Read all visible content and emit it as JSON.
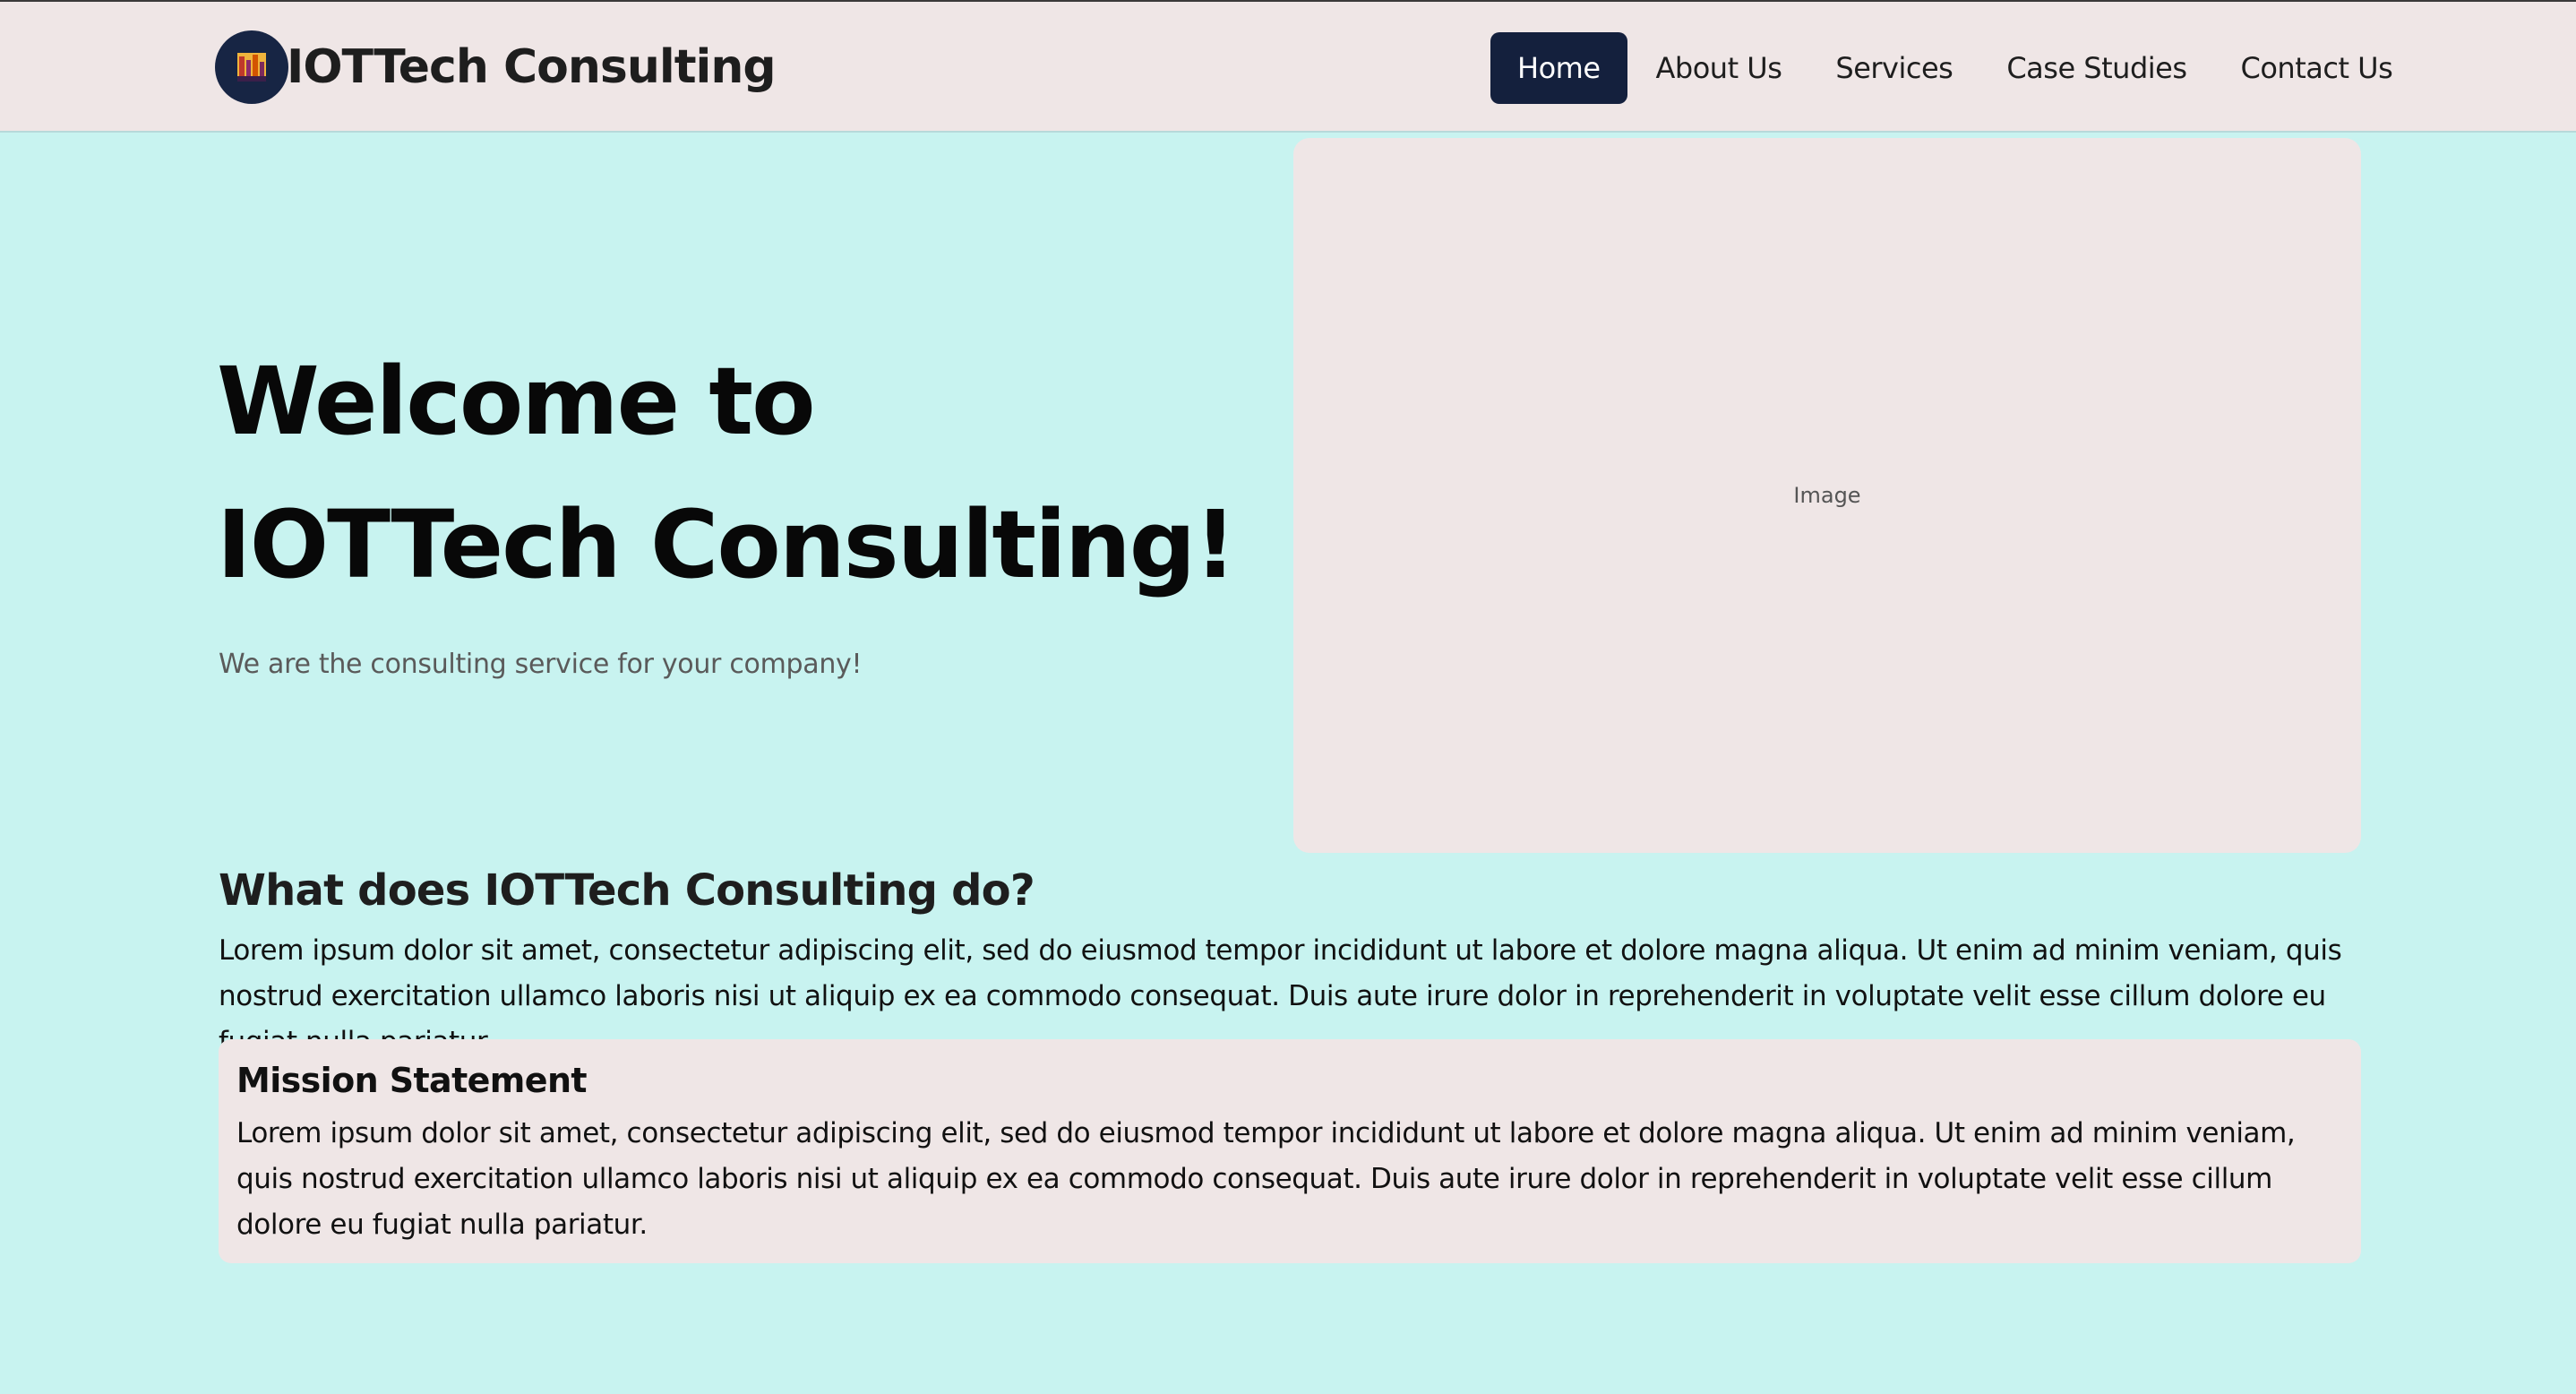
{
  "header": {
    "brand_name": "IOTTech Consulting",
    "nav": [
      {
        "label": "Home",
        "active": true
      },
      {
        "label": "About Us",
        "active": false
      },
      {
        "label": "Services",
        "active": false
      },
      {
        "label": "Case Studies",
        "active": false
      },
      {
        "label": "Contact Us",
        "active": false
      }
    ]
  },
  "hero": {
    "title": "Welcome to IOTTech Consulting!",
    "subtitle": "We are the consulting service for your company!",
    "image_placeholder": "Image"
  },
  "about": {
    "title": "What does IOTTech Consulting do?",
    "body": "Lorem ipsum dolor sit amet, consectetur adipiscing elit, sed do eiusmod tempor incididunt ut labore et dolore magna aliqua. Ut enim ad minim veniam, quis nostrud exercitation ullamco laboris nisi ut aliquip ex ea commodo consequat. Duis aute irure dolor in reprehenderit in voluptate velit esse cillum dolore eu fugiat nulla pariatur."
  },
  "mission": {
    "title": "Mission Statement",
    "body": "Lorem ipsum dolor sit amet, consectetur adipiscing elit, sed do eiusmod tempor incididunt ut labore et dolore magna aliqua. Ut enim ad minim veniam, quis nostrud exercitation ullamco laboris nisi ut aliquip ex ea commodo consequat. Duis aute irure dolor in reprehenderit in voluptate velit esse cillum dolore eu fugiat nulla pariatur."
  },
  "colors": {
    "page_background": "#c8f3f0",
    "header_background": "#efe6e6",
    "nav_active_background": "#14203d",
    "card_background": "#efe6e6"
  },
  "icons": {
    "logo": "city-skyline-logo-icon"
  }
}
